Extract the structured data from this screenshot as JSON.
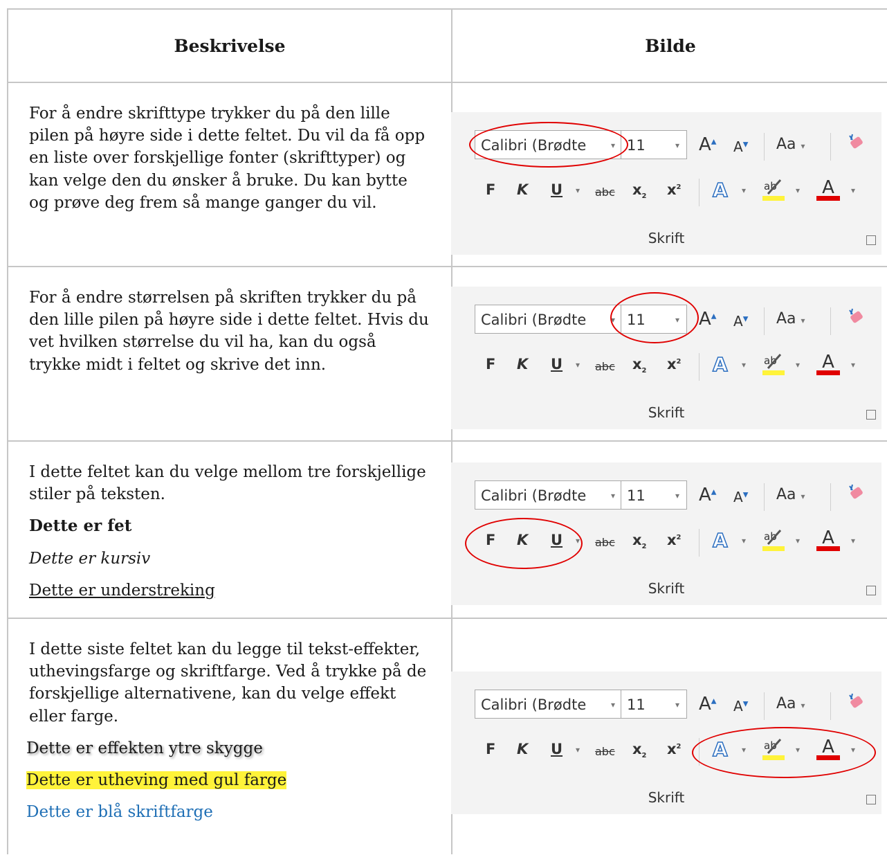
{
  "table": {
    "header_description": "Beskrivelse",
    "header_image": "Bilde"
  },
  "rows": [
    {
      "text": "For å endre skrifttype trykker du på den lille pilen på høyre side i dette feltet. Du vil da få opp en liste over forskjellige fonter (skrifttyper) og kan velge den du ønsker å bruke. Du kan bytte og prøve deg frem så mange ganger du vil."
    },
    {
      "text": "For å endre størrelsen på skriften trykker du på den lille pilen på høyre side i dette feltet. Hvis du vet hvilken størrelse du vil ha, kan du også trykke midt i feltet og skrive det inn."
    },
    {
      "text": "I dette feltet kan du velge mellom tre forskjellige stiler på teksten.",
      "bold_example": "Dette er fet",
      "italic_example": "Dette er kursiv",
      "underline_example": "Dette er understreking"
    },
    {
      "text": "I dette siste feltet kan du legge til tekst-effekter, uthevingsfarge og skriftfarge. Ved å trykke på de forskjellige alternativene, kan du velge effekt eller farge.",
      "shadow_example": "Dette er effekten ytre skygge",
      "highlight_example": "Dette er utheving med gul farge",
      "blue_example": "Dette er blå skriftfarge"
    }
  ],
  "ribbon": {
    "font_name": "Calibri (Brødte",
    "font_size": "11",
    "grow_label": "A",
    "shrink_label": "A",
    "case_label": "Aa",
    "bold_label": "F",
    "italic_label": "K",
    "underline_label": "U",
    "strike_label": "abc",
    "subscript_label": "x",
    "superscript_label": "x",
    "text_effect_label": "A",
    "font_color_label": "A",
    "group_label": "Skrift",
    "dropdown_glyph": "▾"
  },
  "colors": {
    "circle": "#e00000",
    "highlight": "#fff33a",
    "font_color_bar": "#e00000",
    "blue_text": "#1f6fb5"
  }
}
